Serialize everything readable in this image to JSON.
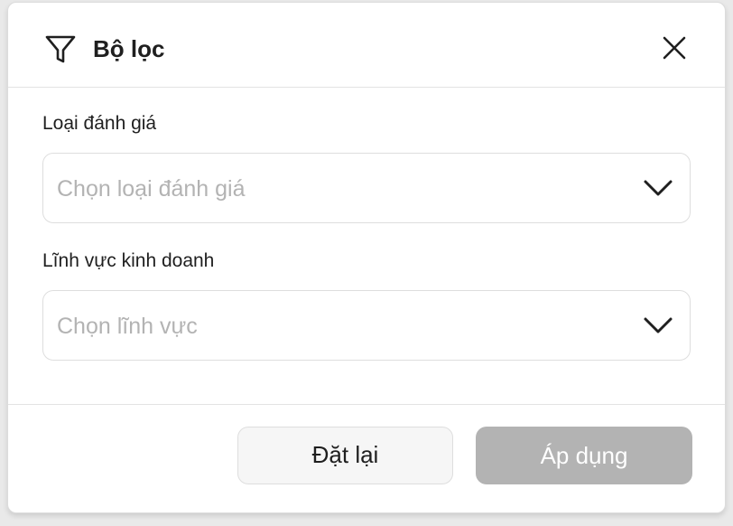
{
  "dialog": {
    "title": "Bộ lọc",
    "icons": {
      "filter": "filter-icon",
      "close": "close-icon",
      "chevron": "chevron-down-icon"
    }
  },
  "fields": [
    {
      "label": "Loại đánh giá",
      "placeholder": "Chọn loại đánh giá"
    },
    {
      "label": "Lĩnh vực kinh doanh",
      "placeholder": "Chọn lĩnh vực"
    }
  ],
  "footer": {
    "reset_label": "Đặt lại",
    "apply_label": "Áp dụng"
  },
  "colors": {
    "text": "#1f1f1f",
    "placeholder": "#b3b3b3",
    "apply_disabled_bg": "#b3b3b3",
    "reset_bg": "#f6f6f6",
    "border": "#dedede"
  }
}
